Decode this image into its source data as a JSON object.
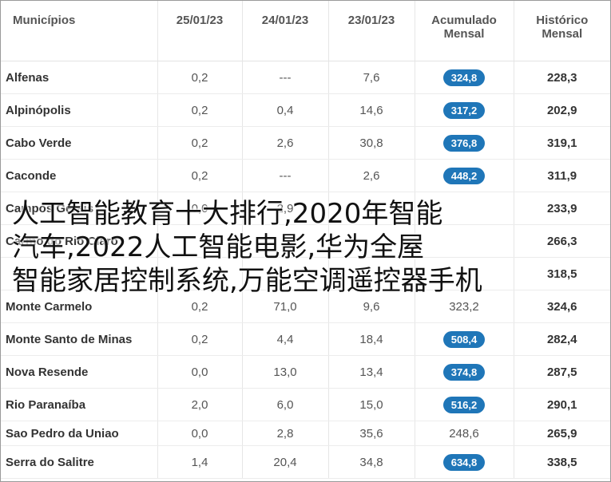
{
  "table": {
    "headers": {
      "municipios": "Municípios",
      "d1": "25/01/23",
      "d2": "24/01/23",
      "d3": "23/01/23",
      "acumulado_l1": "Acumulado",
      "acumulado_l2": "Mensal",
      "historico_l1": "Histórico",
      "historico_l2": "Mensal"
    },
    "rows": [
      {
        "name": "Alfenas",
        "d1": "0,2",
        "d2": "---",
        "d3": "7,6",
        "acum": "324,8",
        "hist": "228,3"
      },
      {
        "name": "Alpinópolis",
        "d1": "0,2",
        "d2": "0,4",
        "d3": "14,6",
        "acum": "317,2",
        "hist": "202,9"
      },
      {
        "name": "Cabo Verde",
        "d1": "0,2",
        "d2": "2,6",
        "d3": "30,8",
        "acum": "376,8",
        "hist": "319,1"
      },
      {
        "name": "Caconde",
        "d1": "0,2",
        "d2": "---",
        "d3": "2,6",
        "acum": "448,2",
        "hist": "311,9"
      },
      {
        "name": "Campos Gerais",
        "d1": "0,0",
        "d2": "2,9",
        "d3": "4,4",
        "acum": "",
        "hist": "233,9"
      },
      {
        "name": "Carmo do Rio Claro",
        "d1": "",
        "d2": "",
        "d3": "",
        "acum": "",
        "hist": "266,3"
      },
      {
        "name": "",
        "d1": "",
        "d2": "",
        "d3": "",
        "acum": "",
        "hist": "318,5"
      },
      {
        "name": "Monte Carmelo",
        "d1": "0,2",
        "d2": "71,0",
        "d3": "9,6",
        "acum": "323,2",
        "hist": "324,6"
      },
      {
        "name": "Monte Santo de Minas",
        "d1": "0,2",
        "d2": "4,4",
        "d3": "18,4",
        "acum": "508,4",
        "hist": "282,4"
      },
      {
        "name": "Nova Resende",
        "d1": "0,0",
        "d2": "13,0",
        "d3": "13,4",
        "acum": "374,8",
        "hist": "287,5"
      },
      {
        "name": "Rio Paranaíba",
        "d1": "2,0",
        "d2": "6,0",
        "d3": "15,0",
        "acum": "516,2",
        "hist": "290,1"
      },
      {
        "name": "Sao Pedro da Uniao",
        "d1": "0,0",
        "d2": "2,8",
        "d3": "35,6",
        "acum": "248,6",
        "hist": "265,9"
      },
      {
        "name": "Serra do Salitre",
        "d1": "1,4",
        "d2": "20,4",
        "d3": "34,8",
        "acum": "634,8",
        "hist": "338,5"
      }
    ]
  },
  "overlay_text": {
    "line1": "人工智能教育十大排行,2020年智能",
    "line2": "汽车,2022人工智能电影,华为全屋",
    "line3": "智能家居控制系统,万能空调遥控器手机"
  },
  "colors": {
    "pill": "#1f76b8",
    "header_text": "#555555"
  }
}
